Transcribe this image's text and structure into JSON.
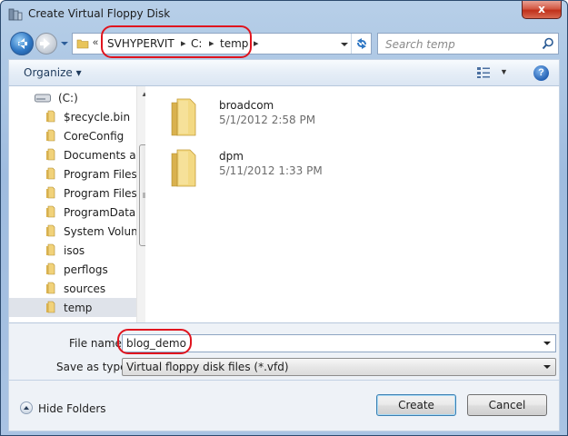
{
  "window": {
    "title": "Create Virtual Floppy Disk",
    "close_label": "x"
  },
  "address_bar": {
    "overflow_glyph": "«",
    "segments": [
      "SVHYPERVIT",
      "C:",
      "temp"
    ]
  },
  "search": {
    "placeholder": "Search temp"
  },
  "toolbar": {
    "organize_label": "Organize ▾",
    "help_label": "?"
  },
  "nav_tree": {
    "drive_label": "(C:)",
    "items": [
      {
        "label": "$recycle.bin"
      },
      {
        "label": "CoreConfig"
      },
      {
        "label": "Documents and"
      },
      {
        "label": "Program Files"
      },
      {
        "label": "Program Files ("
      },
      {
        "label": "ProgramData"
      },
      {
        "label": "System Volume"
      },
      {
        "label": "isos"
      },
      {
        "label": "perflogs"
      },
      {
        "label": "sources"
      },
      {
        "label": "temp",
        "selected": true
      }
    ]
  },
  "files": [
    {
      "name": "broadcom",
      "date": "5/1/2012 2:58 PM"
    },
    {
      "name": "dpm",
      "date": "5/11/2012 1:33 PM"
    }
  ],
  "form": {
    "file_name_label": "File name:",
    "file_name_value": "blog_demo",
    "save_as_label": "Save as type:",
    "save_as_value": "Virtual floppy disk files   (*.vfd)"
  },
  "footer": {
    "hide_folders_label": "Hide Folders",
    "create_label": "Create",
    "cancel_label": "Cancel"
  },
  "colors": {
    "annotation": "#e0141e",
    "folder": "#e8c45a",
    "accent": "#2f77c4"
  }
}
